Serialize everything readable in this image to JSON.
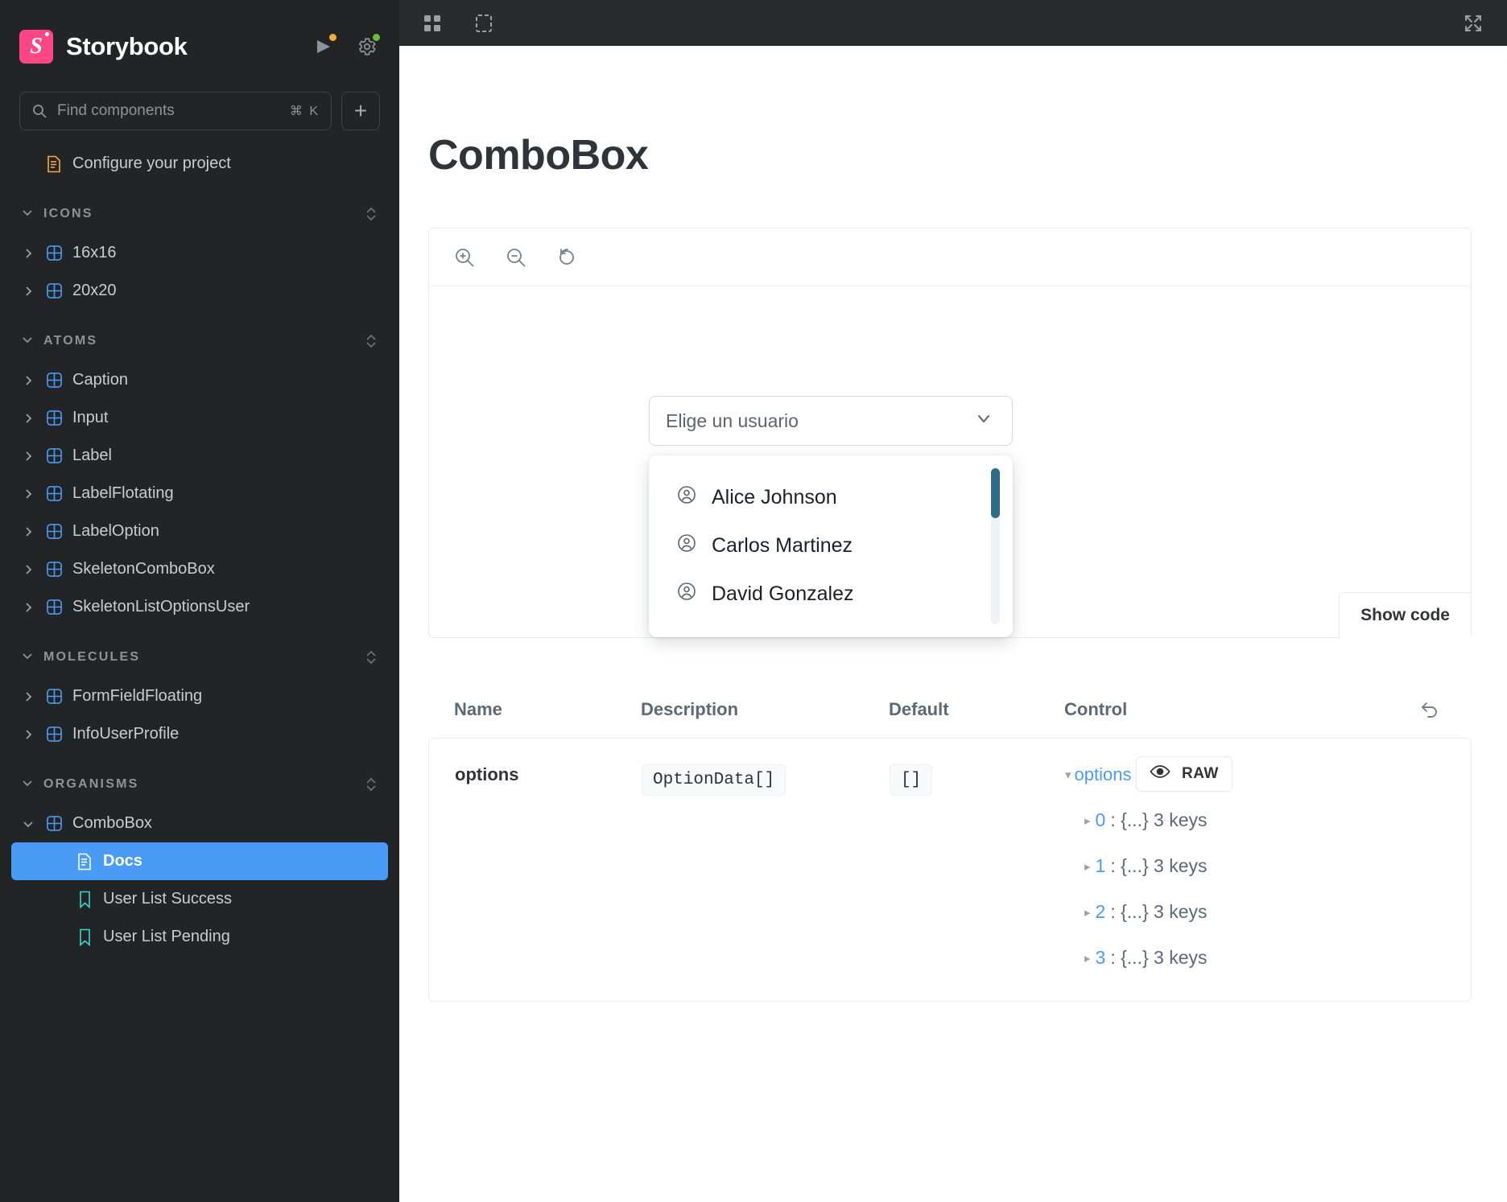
{
  "app": {
    "brand": "Storybook",
    "logo_letter": "S",
    "brand_color": "#ff4785",
    "accent_color": "#4a9bf5",
    "status_dots": [
      {
        "name": "publish-status-dot",
        "color": "#f5ab3c"
      },
      {
        "name": "settings-status-dot",
        "color": "#66bf3c"
      }
    ]
  },
  "search": {
    "placeholder": "Find components",
    "shortcut": "⌘ K",
    "add_label": "+"
  },
  "sidebar": {
    "configure": {
      "label": "Configure your project",
      "icon": "document-icon"
    },
    "sections": [
      {
        "label": "ICONS",
        "expanded": true,
        "items": [
          {
            "label": "16x16",
            "icon": "component-icon",
            "expanded": false
          },
          {
            "label": "20x20",
            "icon": "component-icon",
            "expanded": false
          }
        ]
      },
      {
        "label": "ATOMS",
        "expanded": true,
        "items": [
          {
            "label": "Caption",
            "icon": "component-icon",
            "expanded": false
          },
          {
            "label": "Input",
            "icon": "component-icon",
            "expanded": false
          },
          {
            "label": "Label",
            "icon": "component-icon",
            "expanded": false
          },
          {
            "label": "LabelFlotating",
            "icon": "component-icon",
            "expanded": false
          },
          {
            "label": "LabelOption",
            "icon": "component-icon",
            "expanded": false
          },
          {
            "label": "SkeletonComboBox",
            "icon": "component-icon",
            "expanded": false
          },
          {
            "label": "SkeletonListOptionsUser",
            "icon": "component-icon",
            "expanded": false
          }
        ]
      },
      {
        "label": "MOLECULES",
        "expanded": true,
        "items": [
          {
            "label": "FormFieldFloating",
            "icon": "component-icon",
            "expanded": false
          },
          {
            "label": "InfoUserProfile",
            "icon": "component-icon",
            "expanded": false
          }
        ]
      },
      {
        "label": "ORGANISMS",
        "expanded": true,
        "items": [
          {
            "label": "ComboBox",
            "icon": "component-icon",
            "expanded": true
          }
        ],
        "stories": [
          {
            "label": "Docs",
            "icon": "docs-icon",
            "selected": true
          },
          {
            "label": "User List Success",
            "icon": "bookmark-icon",
            "selected": false
          },
          {
            "label": "User List Pending",
            "icon": "bookmark-icon",
            "selected": false
          }
        ]
      }
    ]
  },
  "toolbar": {
    "icons": [
      {
        "name": "grid-view-icon"
      },
      {
        "name": "measure-icon"
      }
    ],
    "fullscreen_icon": "fullscreen-icon"
  },
  "doc": {
    "title": "ComboBox",
    "preview_toolbar": [
      {
        "name": "zoom-in-icon"
      },
      {
        "name": "zoom-out-icon"
      },
      {
        "name": "zoom-reset-icon"
      }
    ],
    "show_code_label": "Show code"
  },
  "combobox": {
    "placeholder": "Elige un usuario",
    "chevron_icon": "chevron-down-icon",
    "options": [
      {
        "label": "Alice Johnson",
        "icon": "user-circle-icon"
      },
      {
        "label": "Carlos Martinez",
        "icon": "user-circle-icon"
      },
      {
        "label": "David Gonzalez",
        "icon": "user-circle-icon"
      }
    ],
    "scrollbar_color": "#2e6c87"
  },
  "args_table": {
    "columns": [
      "Name",
      "Description",
      "Default",
      "Control"
    ],
    "reset_icon": "reset-icon",
    "rows": [
      {
        "name": "options",
        "description_type": "OptionData[]",
        "default": "[]",
        "control": {
          "root_key": "options",
          "raw_label": "RAW",
          "raw_icon": "eye-icon",
          "children": [
            {
              "index": "0",
              "summary": ": {...} 3 keys"
            },
            {
              "index": "1",
              "summary": ": {...} 3 keys"
            },
            {
              "index": "2",
              "summary": ": {...} 3 keys"
            },
            {
              "index": "3",
              "summary": ": {...} 3 keys"
            }
          ]
        }
      }
    ]
  }
}
